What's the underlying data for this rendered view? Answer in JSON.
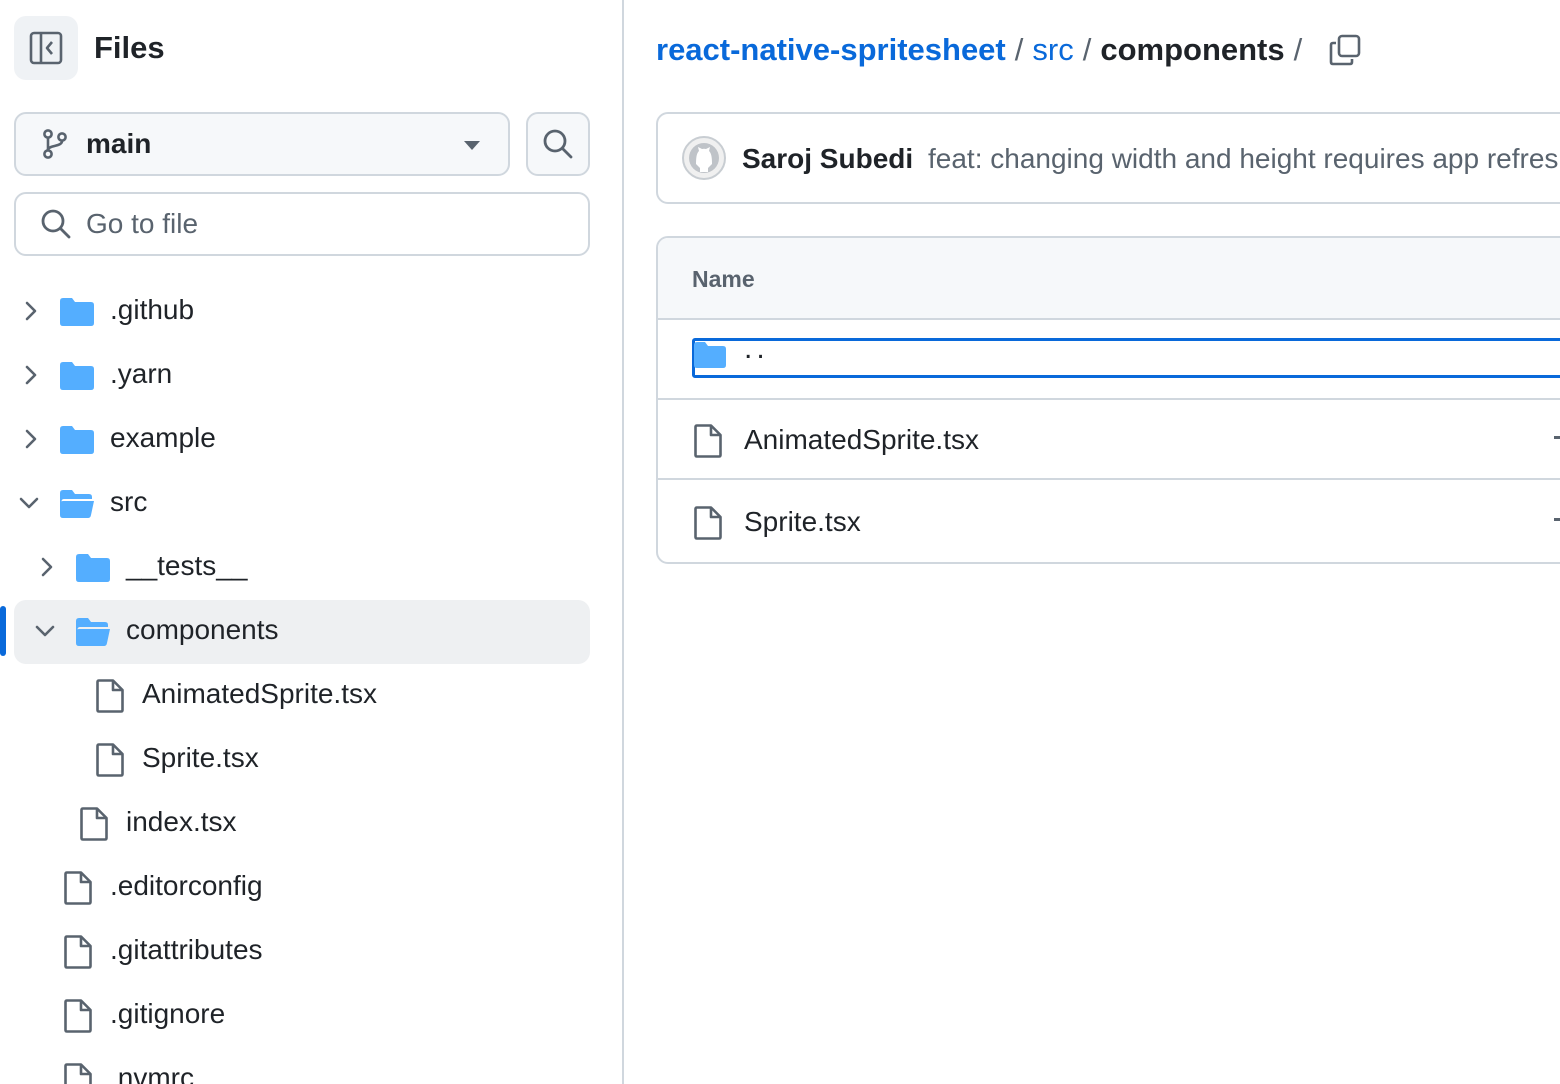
{
  "sidebar": {
    "title": "Files",
    "branch": "main",
    "search_placeholder": "Go to file",
    "tree": [
      {
        "label": ".github",
        "type": "folder",
        "expanded": false
      },
      {
        "label": ".yarn",
        "type": "folder",
        "expanded": false
      },
      {
        "label": "example",
        "type": "folder",
        "expanded": false
      },
      {
        "label": "src",
        "type": "folder",
        "expanded": true
      },
      {
        "label": "__tests__",
        "type": "folder",
        "expanded": false
      },
      {
        "label": "components",
        "type": "folder",
        "expanded": true,
        "selected": true
      },
      {
        "label": "AnimatedSprite.tsx",
        "type": "file"
      },
      {
        "label": "Sprite.tsx",
        "type": "file"
      },
      {
        "label": "index.tsx",
        "type": "file"
      },
      {
        "label": ".editorconfig",
        "type": "file"
      },
      {
        "label": ".gitattributes",
        "type": "file"
      },
      {
        "label": ".gitignore",
        "type": "file"
      },
      {
        "label": ".nvmrc",
        "type": "file"
      }
    ]
  },
  "breadcrumb": {
    "repo": "react-native-spritesheet",
    "folder": "src",
    "current": "components",
    "separator": "/"
  },
  "commit": {
    "author": "Saroj Subedi",
    "message": "feat: changing width and height requires app refresh"
  },
  "files_table": {
    "header": "Name",
    "rows": [
      {
        "name": "..",
        "type": "parent"
      },
      {
        "name": "AnimatedSprite.tsx",
        "type": "file"
      },
      {
        "name": "Sprite.tsx",
        "type": "file"
      }
    ]
  },
  "colors": {
    "accent": "#0969da",
    "folder": "#54aeff",
    "border": "#d0d7de",
    "muted_text": "#59636e",
    "selected_bg": "#eef0f2"
  },
  "icons": {
    "panel_toggle": "sidebar-collapse-icon",
    "branch": "git-branch-icon",
    "search": "search-icon",
    "copy": "copy-icon",
    "folder": "folder-icon",
    "file": "file-icon",
    "avatar": "github-avatar-icon"
  }
}
